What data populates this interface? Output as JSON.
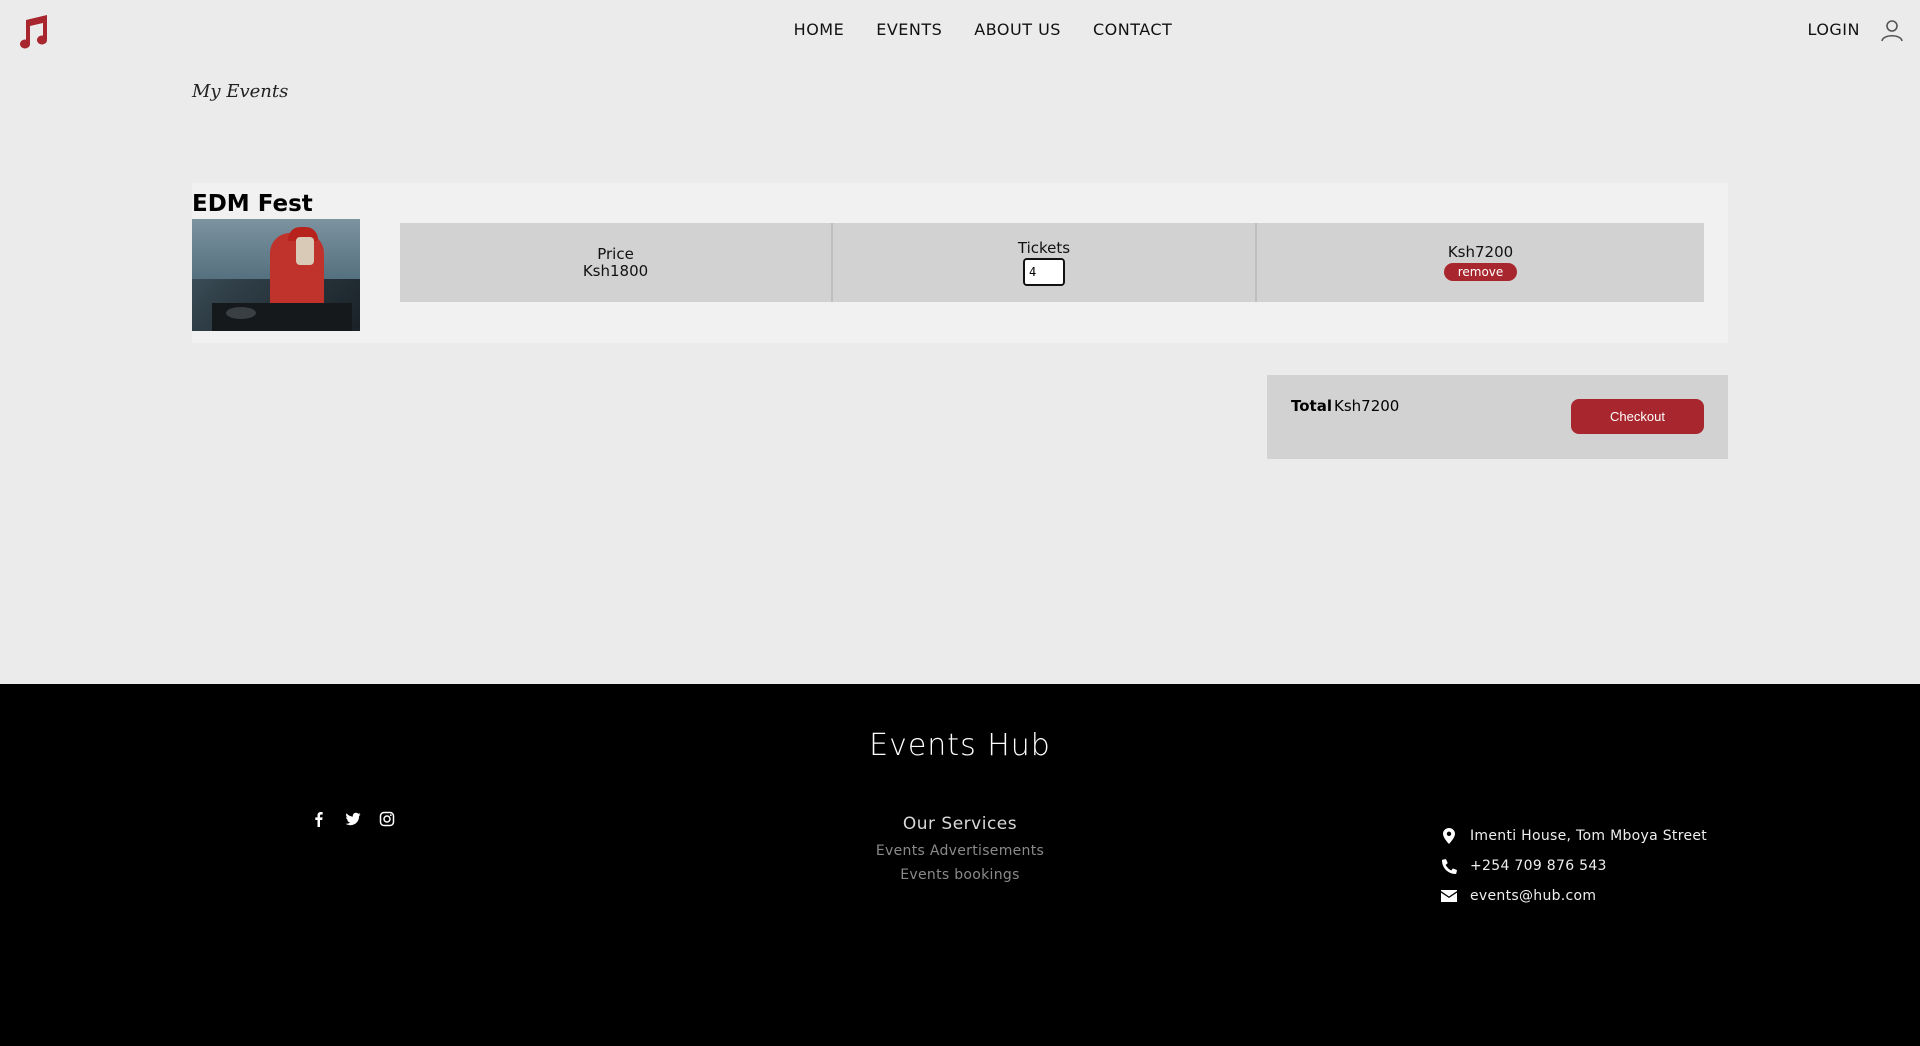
{
  "header": {
    "nav": [
      "HOME",
      "EVENTS",
      "ABOUT US",
      "CONTACT"
    ],
    "login_label": "LOGIN"
  },
  "main": {
    "page_title": "My Events",
    "event": {
      "name": "EDM Fest",
      "price_label": "Price",
      "price_value": "Ksh1800",
      "tickets_label": "Tickets",
      "tickets_value": "4",
      "subtotal": "Ksh7200",
      "remove_label": "remove"
    },
    "total": {
      "label": "Total",
      "value": "Ksh7200",
      "checkout_label": "Checkout"
    }
  },
  "footer": {
    "brand": "Events Hub",
    "services_title": "Our Services",
    "services": [
      "Events Advertisements",
      "Events bookings"
    ],
    "address": "Imenti House, Tom Mboya Street",
    "phone": "+254 709 876 543",
    "email": "events@hub.com"
  },
  "colors": {
    "accent": "#a8262d",
    "background": "#ebebeb",
    "footer_bg": "#000000"
  },
  "icons": [
    "music-note-icon",
    "user-icon",
    "facebook-icon",
    "twitter-icon",
    "instagram-icon",
    "map-marker-icon",
    "phone-icon",
    "envelope-icon"
  ]
}
